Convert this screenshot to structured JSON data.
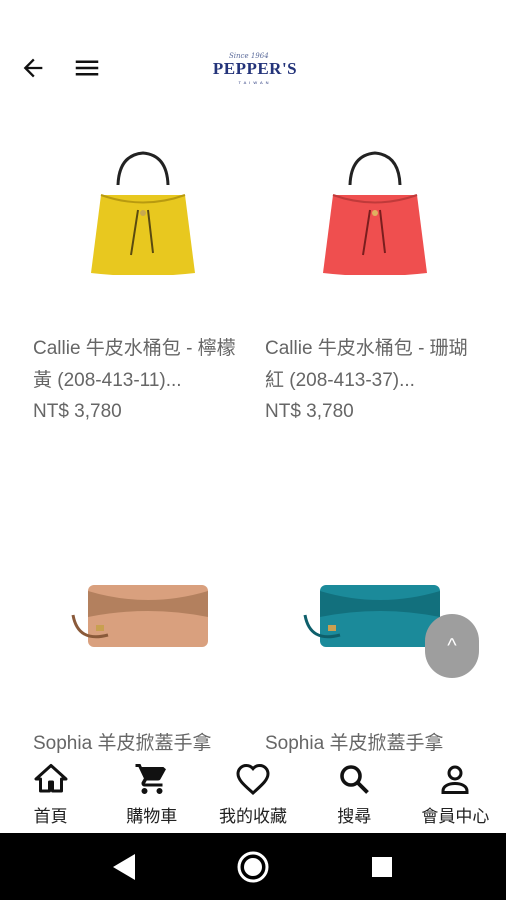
{
  "header": {
    "logo_script": "Since 1964",
    "logo_brand": "PEPPER'S",
    "logo_sub": "TAIWAN"
  },
  "products": [
    {
      "name": "Callie 牛皮水桶包 - 檸檬黃 (208-413-11)...",
      "price": "NT$ 3,780",
      "color": "#e8c81f"
    },
    {
      "name": "Callie 牛皮水桶包 - 珊瑚紅 (208-413-37)...",
      "price": "NT$ 3,780",
      "color": "#ef4f4f"
    },
    {
      "name": "Sophia 羊皮掀蓋手拿",
      "price": "",
      "color": "#d9a07e"
    },
    {
      "name": "Sophia 羊皮掀蓋手拿",
      "price": "",
      "color": "#1b8a9a"
    }
  ],
  "scroll_top_label": "^",
  "nav": [
    {
      "label": "首頁",
      "icon": "home-icon"
    },
    {
      "label": "購物車",
      "icon": "cart-icon"
    },
    {
      "label": "我的收藏",
      "icon": "heart-icon"
    },
    {
      "label": "搜尋",
      "icon": "search-icon"
    },
    {
      "label": "會員中心",
      "icon": "person-icon"
    }
  ]
}
